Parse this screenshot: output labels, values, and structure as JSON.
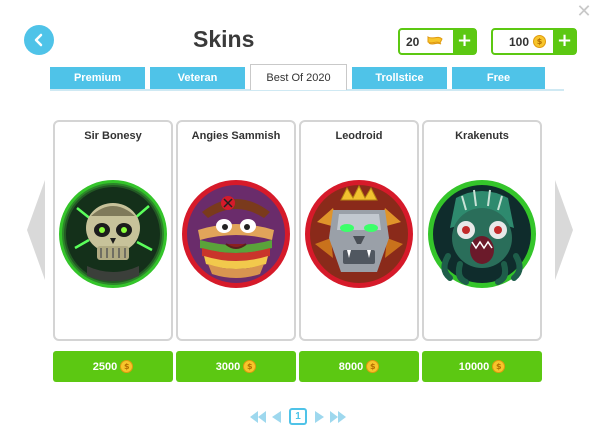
{
  "header": {
    "title": "Skins",
    "tickets": "20",
    "coins": "100",
    "back_icon": "chevron-left-icon",
    "close_icon": "close-icon"
  },
  "tabs": [
    {
      "label": "Premium",
      "active": false
    },
    {
      "label": "Veteran",
      "active": false
    },
    {
      "label": "Best Of 2020",
      "active": true
    },
    {
      "label": "Trollstice",
      "active": false
    },
    {
      "label": "Free",
      "active": false
    }
  ],
  "skins": [
    {
      "name": "Sir Bonesy",
      "price": "2500",
      "ring_color": "#34c52a"
    },
    {
      "name": "Angies Sammish",
      "price": "3000",
      "ring_color": "#d61a2a"
    },
    {
      "name": "Leodroid",
      "price": "8000",
      "ring_color": "#d61a2a"
    },
    {
      "name": "Krakenuts",
      "price": "10000",
      "ring_color": "#34c52a"
    }
  ],
  "pagination": {
    "current": "1"
  },
  "colors": {
    "accent_blue": "#4fc3e8",
    "accent_green": "#5cc812",
    "coin_gold": "#f7c52b"
  }
}
